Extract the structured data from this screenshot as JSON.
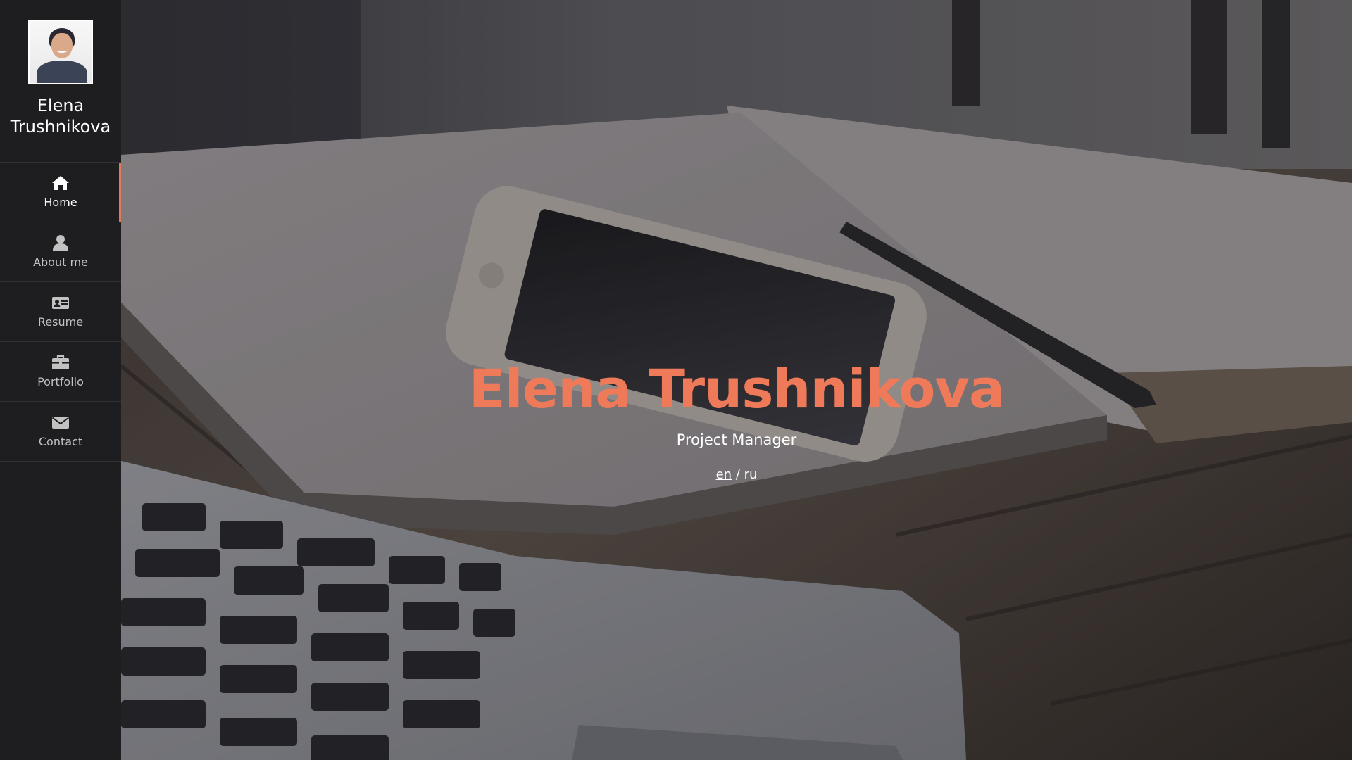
{
  "sidebar": {
    "profile": {
      "name": "Elena Trushnikova"
    },
    "items": [
      {
        "label": "Home",
        "icon": "home-icon",
        "active": true
      },
      {
        "label": "About me",
        "icon": "user-icon",
        "active": false
      },
      {
        "label": "Resume",
        "icon": "id-card-icon",
        "active": false
      },
      {
        "label": "Portfolio",
        "icon": "briefcase-icon",
        "active": false
      },
      {
        "label": "Contact",
        "icon": "envelope-icon",
        "active": false
      }
    ]
  },
  "hero": {
    "title": "Elena Trushnikova",
    "subtitle": "Project Manager",
    "lang": {
      "current": "en",
      "separator": " / ",
      "other": "ru"
    }
  },
  "colors": {
    "accent": "#ef7a5a",
    "sidebar_bg": "#1e1e20",
    "nav_text": "#c2c2c2"
  }
}
